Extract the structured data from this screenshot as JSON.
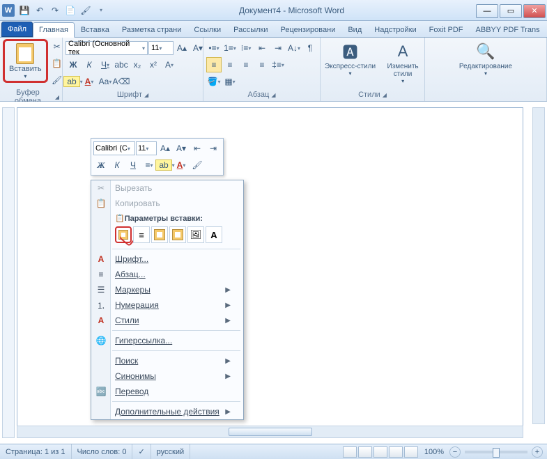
{
  "title": "Документ4 - Microsoft Word",
  "tabs": {
    "file": "Файл",
    "home": "Главная",
    "insert": "Вставка",
    "layout": "Разметка страни",
    "refs": "Ссылки",
    "mail": "Рассылки",
    "review": "Рецензировани",
    "view": "Вид",
    "addins": "Надстройки",
    "foxit": "Foxit PDF",
    "abbyy": "ABBYY PDF Trans"
  },
  "ribbon": {
    "clipboard": {
      "paste": "Вставить",
      "label": "Буфер обмена"
    },
    "font": {
      "name": "Calibri (Основной тек",
      "size": "11",
      "label": "Шрифт",
      "bold": "Ж",
      "italic": "К",
      "underline": "Ч"
    },
    "paragraph": {
      "label": "Абзац"
    },
    "styles": {
      "quick": "Экспресс-стили",
      "change": "Изменить стили",
      "label": "Стили"
    },
    "editing": {
      "label": "Редактирование"
    }
  },
  "mini": {
    "font": "Calibri (С",
    "size": "11",
    "bold": "Ж",
    "italic": "К",
    "underline": "Ч"
  },
  "ctx": {
    "cut": "Вырезать",
    "copy": "Копировать",
    "paste_opts": "Параметры вставки:",
    "font": "Шрифт...",
    "paragraph": "Абзац...",
    "bullets": "Маркеры",
    "numbering": "Нумерация",
    "styles": "Стили",
    "hyperlink": "Гиперссылка...",
    "find": "Поиск",
    "synonyms": "Синонимы",
    "translate": "Перевод",
    "more": "Дополнительные действия"
  },
  "status": {
    "page": "Страница: 1 из 1",
    "words": "Число слов: 0",
    "lang": "русский",
    "zoom": "100%"
  }
}
